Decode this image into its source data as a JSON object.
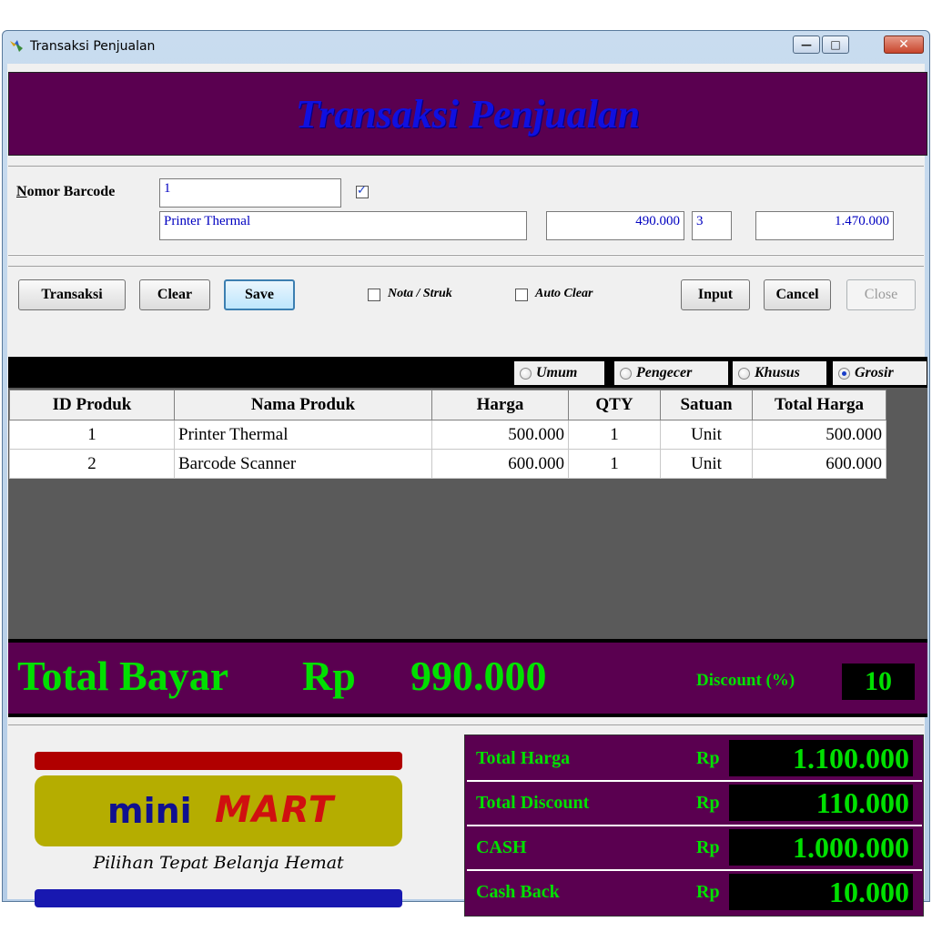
{
  "window": {
    "title": "Transaksi Penjualan",
    "minimize_glyph": "—",
    "maximize_glyph": "□",
    "close_glyph": "✕"
  },
  "header": {
    "title": "Transaksi Penjualan"
  },
  "barcode": {
    "label_accel": "N",
    "label_rest": "omor Barcode",
    "value": "1",
    "checked": true,
    "product_name": "Printer Thermal",
    "price": "490.000",
    "qty": "3",
    "total": "1.470.000"
  },
  "toolbar": {
    "transaksi": "Transaksi",
    "clear": "Clear",
    "save": "Save",
    "nota_label": "Nota / Struk",
    "auto_clear_label": "Auto Clear",
    "input": "Input",
    "cancel": "Cancel",
    "close": "Close"
  },
  "price_type": {
    "options": [
      "Umum",
      "Pengecer",
      "Khusus",
      "Grosir"
    ],
    "selected": "Grosir"
  },
  "table": {
    "headers": [
      "ID Produk",
      "Nama Produk",
      "Harga",
      "QTY",
      "Satuan",
      "Total Harga"
    ],
    "rows": [
      [
        "1",
        "Printer Thermal",
        "500.000",
        "1",
        "Unit",
        "500.000"
      ],
      [
        "2",
        "Barcode Scanner",
        "600.000",
        "1",
        "Unit",
        "600.000"
      ]
    ]
  },
  "total_bayar": {
    "label": "Total Bayar",
    "currency": "Rp",
    "value": "990.000",
    "discount_label": "Discount (%)",
    "discount_value": "10"
  },
  "logo": {
    "mini": "mini",
    "mart": "MART",
    "tagline": "Pilihan Tepat Belanja Hemat"
  },
  "summary": {
    "rows": [
      {
        "label": "Total Harga",
        "currency": "Rp",
        "value": "1.100.000"
      },
      {
        "label": "Total Discount",
        "currency": "Rp",
        "value": "110.000"
      },
      {
        "label": "CASH",
        "currency": "Rp",
        "value": "1.000.000"
      },
      {
        "label": "Cash Back",
        "currency": "Rp",
        "value": "10.000"
      }
    ]
  },
  "colors": {
    "header_bg": "#5a0050",
    "title_blue": "#1010e0",
    "money_green": "#00e000",
    "grid_bg": "#5a5a5a"
  }
}
